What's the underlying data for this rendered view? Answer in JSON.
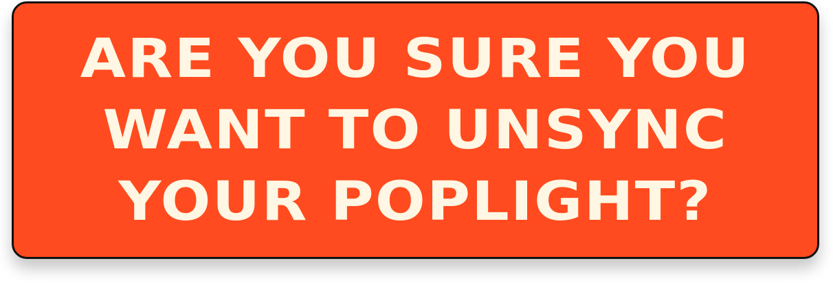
{
  "dialog": {
    "message_lines": [
      "ARE YOU SURE YOU",
      "WANT TO UNSYNC",
      "YOUR POPLIGHT?"
    ]
  },
  "colors": {
    "card_background": "#FF4B1F",
    "card_border": "#111111",
    "text": "#FFF6E3",
    "page_background": "#FFFFFF"
  }
}
